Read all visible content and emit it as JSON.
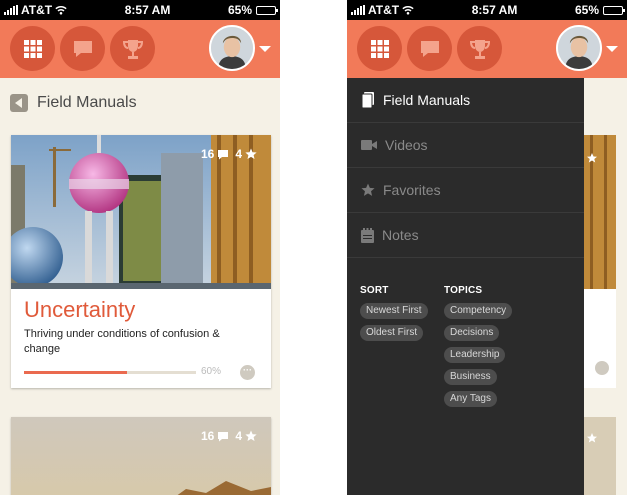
{
  "status_bar": {
    "carrier": "AT&T",
    "time": "8:57 AM",
    "battery": "65%",
    "battery_level": 0.65
  },
  "header": {
    "buttons": [
      {
        "icon": "grid-icon"
      },
      {
        "icon": "chat-bubble-icon"
      },
      {
        "icon": "trophy-icon"
      }
    ],
    "avatar_icon": "user-avatar",
    "dropdown_icon": "caret-down-icon"
  },
  "left_screen": {
    "breadcrumb": {
      "back_icon": "back-arrow-icon",
      "title": "Field Manuals"
    },
    "cards": [
      {
        "comments": "16",
        "stars": "4",
        "title": "Uncertainty",
        "description": "Thriving under conditions of confusion & change",
        "progress": 0.6,
        "progress_label": "60%"
      },
      {
        "comments": "16",
        "stars": "4"
      }
    ]
  },
  "right_screen": {
    "menu": [
      {
        "label": "Field Manuals",
        "icon": "book-icon",
        "active": true
      },
      {
        "label": "Videos",
        "icon": "video-camera-icon",
        "active": false
      },
      {
        "label": "Favorites",
        "icon": "star-icon",
        "active": false
      },
      {
        "label": "Notes",
        "icon": "notepad-icon",
        "active": false
      }
    ],
    "sort": {
      "heading": "SORT",
      "options": [
        "Newest First",
        "Oldest First"
      ]
    },
    "topics": {
      "heading": "TOPICS",
      "options": [
        "Competency",
        "Decisions",
        "Leadership",
        "Business",
        "Any Tags"
      ]
    }
  },
  "colors": {
    "header": "#f27a59",
    "header_button": "#d6573a",
    "accent": "#e05a3a",
    "drawer": "#2b2b2b",
    "background": "#f5f1e6"
  }
}
